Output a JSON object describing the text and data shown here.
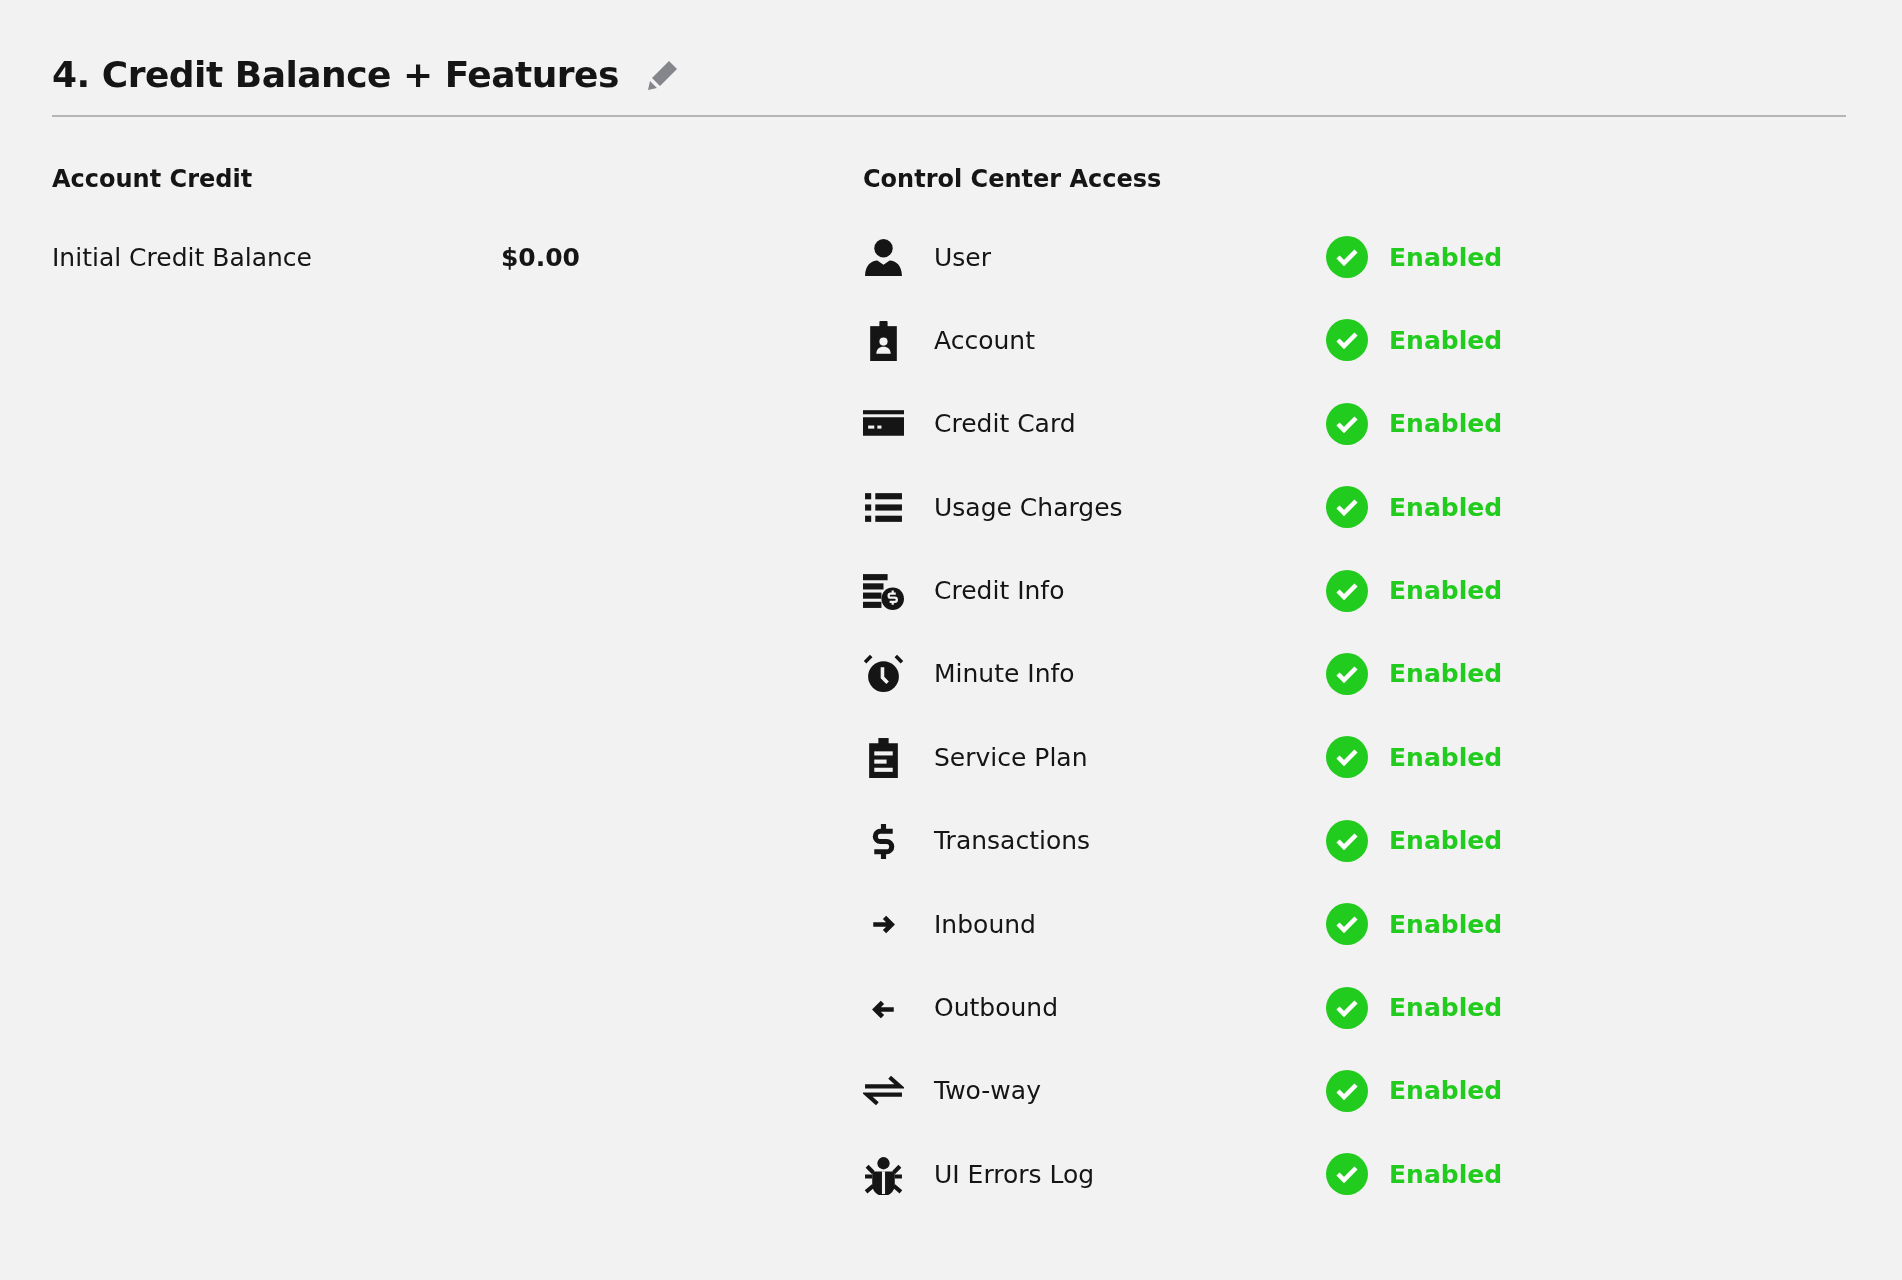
{
  "section": {
    "title": "4. Credit Balance + Features"
  },
  "account_credit": {
    "heading": "Account Credit",
    "rows": [
      {
        "label": "Initial Credit Balance",
        "value": "$0.00"
      }
    ]
  },
  "control_center_access": {
    "heading": "Control Center Access",
    "items": [
      {
        "label": "User",
        "status": "Enabled",
        "enabled": true
      },
      {
        "label": "Account",
        "status": "Enabled",
        "enabled": true
      },
      {
        "label": "Credit Card",
        "status": "Enabled",
        "enabled": true
      },
      {
        "label": "Usage Charges",
        "status": "Enabled",
        "enabled": true
      },
      {
        "label": "Credit Info",
        "status": "Enabled",
        "enabled": true
      },
      {
        "label": "Minute Info",
        "status": "Enabled",
        "enabled": true
      },
      {
        "label": "Service Plan",
        "status": "Enabled",
        "enabled": true
      },
      {
        "label": "Transactions",
        "status": "Enabled",
        "enabled": true
      },
      {
        "label": "Inbound",
        "status": "Enabled",
        "enabled": true
      },
      {
        "label": "Outbound",
        "status": "Enabled",
        "enabled": true
      },
      {
        "label": "Two-way",
        "status": "Enabled",
        "enabled": true
      },
      {
        "label": "UI Errors Log",
        "status": "Enabled",
        "enabled": true
      }
    ]
  }
}
